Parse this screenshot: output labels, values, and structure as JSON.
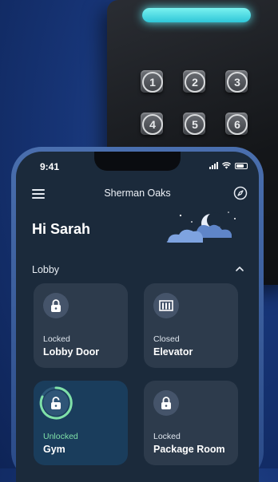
{
  "keypad": {
    "keys": [
      "1",
      "2",
      "3",
      "4",
      "5",
      "6"
    ]
  },
  "status_bar": {
    "time": "9:41"
  },
  "header": {
    "location": "Sherman Oaks"
  },
  "greeting": "Hi Sarah",
  "section": {
    "title": "Lobby"
  },
  "devices": [
    {
      "status": "Locked",
      "name": "Lobby Door",
      "icon": "lock-icon"
    },
    {
      "status": "Closed",
      "name": "Elevator",
      "icon": "elevator-icon"
    },
    {
      "status": "Unlocked",
      "name": "Gym",
      "icon": "unlock-icon"
    },
    {
      "status": "Locked",
      "name": "Package Room",
      "icon": "lock-icon"
    }
  ],
  "colors": {
    "background": "#173577",
    "screen": "#1b2a3b",
    "card": "#2d3b4c",
    "card_active": "#1a3d5c",
    "unlocked_accent": "#7fe0a8",
    "keypad_led": "#4fd8e6"
  }
}
